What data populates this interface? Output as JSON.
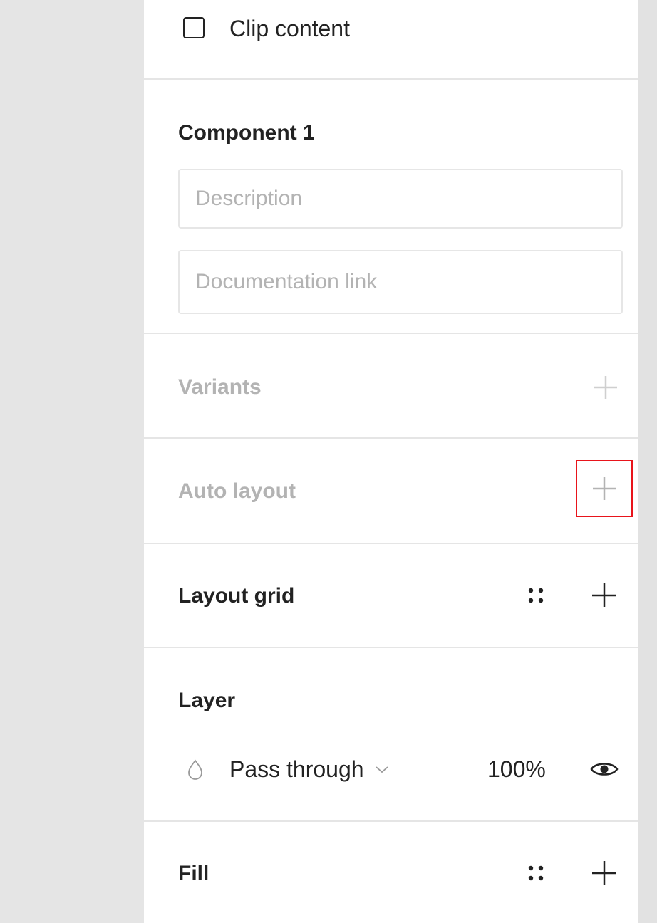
{
  "clip_content": {
    "label": "Clip content",
    "checked": false
  },
  "component": {
    "title": "Component 1",
    "description_placeholder": "Description",
    "documentation_placeholder": "Documentation link"
  },
  "variants": {
    "title": "Variants",
    "add_icon": "plus-icon"
  },
  "auto_layout": {
    "title": "Auto layout",
    "add_icon": "plus-icon",
    "highlight_color": "#e8141b"
  },
  "layout_grid": {
    "title": "Layout grid",
    "styles_icon": "style-grid-icon",
    "add_icon": "plus-icon"
  },
  "layer": {
    "title": "Layer",
    "blend_icon": "drop-icon",
    "blend_mode": "Pass through",
    "opacity": "100%",
    "visibility_icon": "eye-icon"
  },
  "fill": {
    "title": "Fill",
    "styles_icon": "style-grid-icon",
    "add_icon": "plus-icon"
  }
}
